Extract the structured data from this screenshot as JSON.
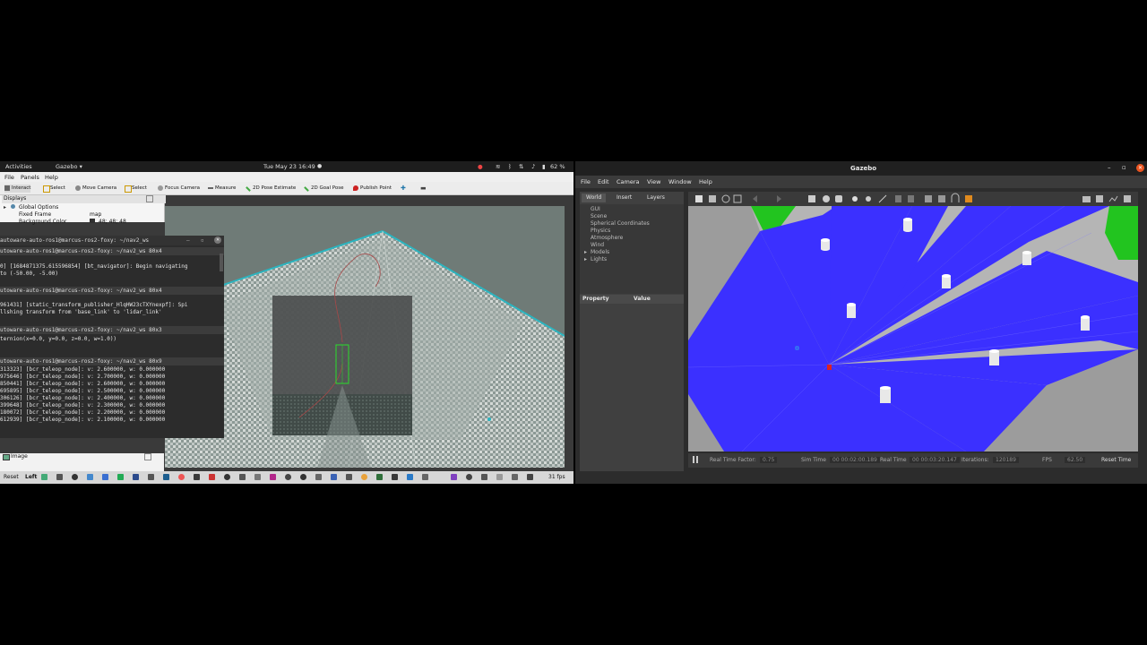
{
  "left": {
    "topbar": {
      "activities": "Activities",
      "app": "Gazebo ▾",
      "clock": "Tue May 23  16:49",
      "battery": "62 %"
    },
    "menu": [
      "File",
      "Panels",
      "Help"
    ],
    "tools": [
      "Interact",
      "Select",
      "Move Camera",
      "Select",
      "Focus Camera",
      "Measure",
      "2D Pose Estimate",
      "2D Goal Pose",
      "Publish Point"
    ],
    "displays": {
      "title": "Displays",
      "global_options": "Global Options",
      "fixed_frame_label": "Fixed Frame",
      "fixed_frame_value": "map",
      "background_label": "Background Color",
      "background_value": "48; 48; 48"
    },
    "terminal": {
      "title": "autoware-auto-ros1@marcus-ros2-foxy: ~/nav2_ws",
      "tabs": [
        {
          "title": "utoware-auto-ros1@marcus-ros2-foxy: ~/nav2_ws 80x4",
          "lines": [
            "0] [1684871375.615596854] [bt_navigator]: Begin navigating",
            " to (-50.00, -5.00)"
          ]
        },
        {
          "title": "utoware-auto-ros1@marcus-ros2-foxy: ~/nav2_ws 80x4",
          "lines": [
            "961431] [static_transform_publisher_HlqHW23cTXYnexpf]: Spi",
            "llshing transform from 'base_link' to 'lidar_link'"
          ]
        },
        {
          "title": "utoware-auto-ros1@marcus-ros2-foxy: ~/nav2_ws 80x3",
          "lines": [
            "ternion(x=0.0, y=0.0, z=0.0, w=1.0))"
          ]
        },
        {
          "title": "utoware-auto-ros1@marcus-ros2-foxy: ~/nav2_ws 80x9",
          "lines": [
            "313323] [bcr_teleop_node]: v: 2.600000, w: 0.000000",
            "975646] [bcr_teleop_node]: v: 2.700000, w: 0.000000",
            "850441] [bcr_teleop_node]: v: 2.600000, w: 0.000000",
            "695895] [bcr_teleop_node]: v: 2.500000, w: 0.000000",
            "306126] [bcr_teleop_node]: v: 2.400000, w: 0.000000",
            "399648] [bcr_teleop_node]: v: 2.300000, w: 0.000000",
            "180072] [bcr_teleop_node]: v: 2.200000, w: 0.000000",
            "612939] [bcr_teleop_node]: v: 2.100000, w: 0.000000"
          ]
        }
      ]
    },
    "image_panel": "Image",
    "reset": "Reset",
    "left_label": "Left",
    "fps": "31 fps"
  },
  "right": {
    "title": "Gazebo",
    "menu": [
      "File",
      "Edit",
      "Camera",
      "View",
      "Window",
      "Help"
    ],
    "tabs": [
      "World",
      "Insert",
      "Layers"
    ],
    "tree": [
      "GUI",
      "Scene",
      "Spherical Coordinates",
      "Physics",
      "Atmosphere",
      "Wind",
      "Models",
      "Lights"
    ],
    "property_header": "Property",
    "value_header": "Value",
    "status": {
      "rtf_label": "Real Time Factor:",
      "rtf_value": "0.75",
      "sim_label": "Sim Time",
      "sim_value": "00 00:02:00.189",
      "real_label": "Real Time",
      "real_value": "00 00:03:20.147",
      "iter_label": "Iterations:",
      "iter_value": "120189",
      "fps_label": "FPS",
      "fps_value": "62.50",
      "reset": "Reset Time"
    },
    "colors": {
      "laser": "#3b30ff",
      "ground": "#9a9a9a",
      "green": "#22c41f"
    }
  }
}
